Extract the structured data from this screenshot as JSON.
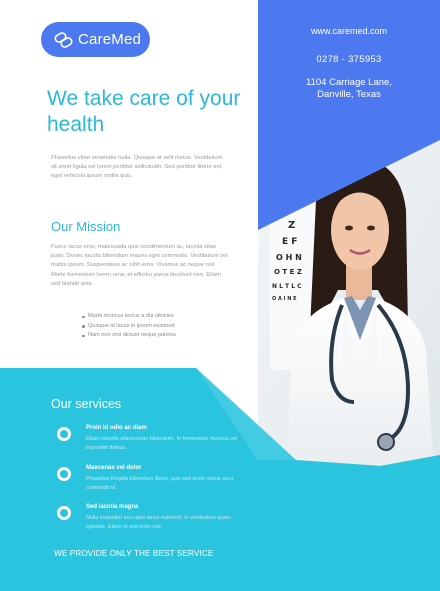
{
  "brand": {
    "name": "CareMed",
    "primary_color": "#4d79f0",
    "accent_color": "#2bb8d8",
    "logo_icon": "pill-capsule-icon"
  },
  "contact": {
    "website": "www.caremed.com",
    "phone": "0278 - 375953",
    "address": "1104  Carriage Lane,  Danville, Texas"
  },
  "hero": {
    "headline": "We take care of your health",
    "intro": "Phasellus vitae venenatis nulla. Quisque at velit metus. Vestibulum sit amet ligula vel lorem porttitor sollicitudin. Sed porttitor libero est, eget vehicula ipsum mollis quis."
  },
  "mission": {
    "title": "Our Mission",
    "text": "Fusce lacus eros, malesuada quis condimentum ac, lacinia vitae justo. Donec iaculis bibendum mauris eget commodo. Vestibulum vel mattis ipsum. Suspendisse ac nibh eros. Vivamus ac neque nisl. Morbi fermentum lorem urna, et efficitur purus tincidunt non. Etiam sed blandit ante.",
    "bullets": [
      "Morbi rhoncus lectus a dui ultricies",
      "Quisque id lacus in ipsum euismod",
      "Nam non orci dictum neque pulvina"
    ]
  },
  "services": {
    "title": "Our services",
    "items": [
      {
        "name": "Proin id odio ac diam",
        "desc": "Etiam lobortis ullamcorper bibendum. In fermentum rhoncus vel imperdiet finibus."
      },
      {
        "name": "Maecenas vel dolor",
        "desc": "Phasellus fringilla bibendum libero, quis sed scele risque arcu commodo id."
      },
      {
        "name": "Sed lacinia magna",
        "desc": "Nulla imperdiet arcu quis lacus euismod, in vestibulum quam egestas. Etiam et sed enim nisl."
      }
    ],
    "tagline": "WE PROVIDE ONLY THE BEST SERVICE"
  }
}
